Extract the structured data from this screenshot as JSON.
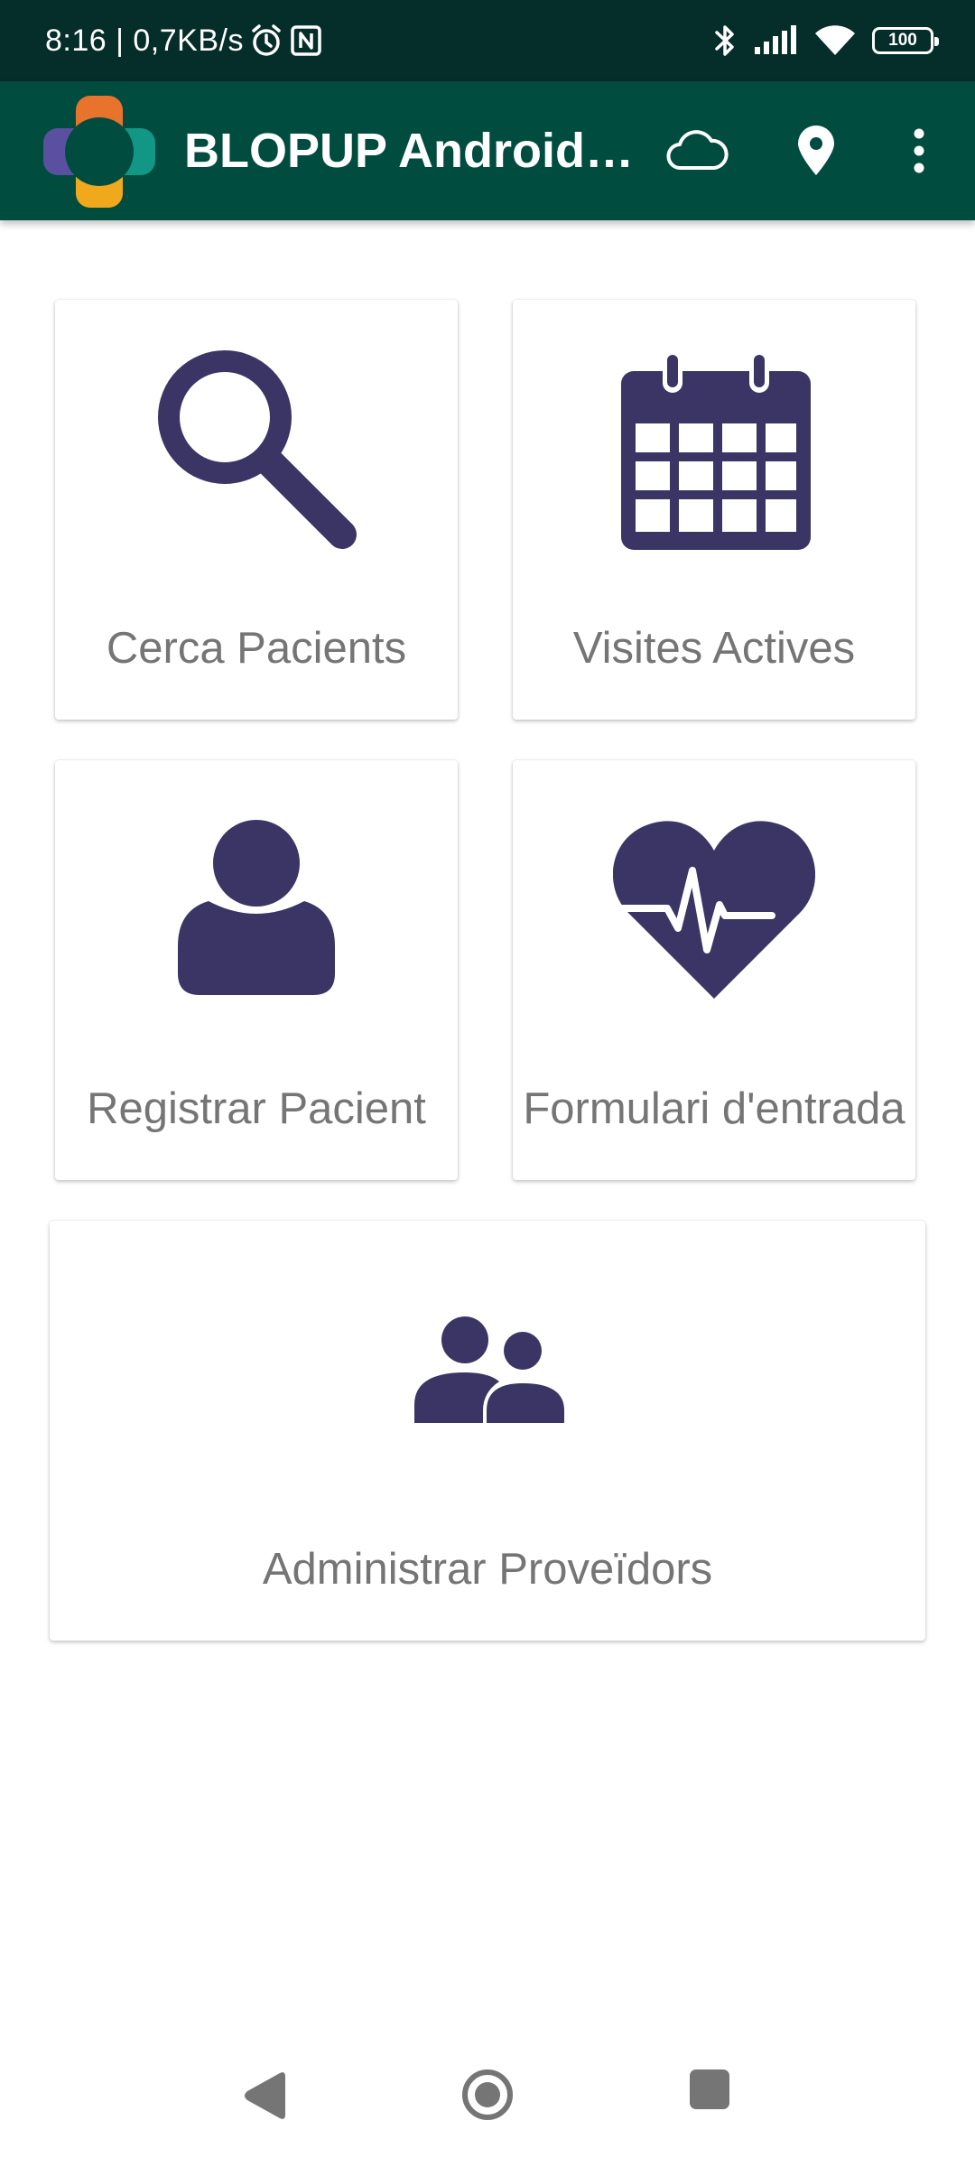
{
  "status_bar": {
    "time_speed": "8:16 | 0,7KB/s",
    "battery": "100"
  },
  "app_bar": {
    "title": "BLOPUP Android…"
  },
  "cards": [
    {
      "label": "Cerca Pacients",
      "icon": "search-icon"
    },
    {
      "label": "Visites Actives",
      "icon": "calendar-icon"
    },
    {
      "label": "Registrar Pacient",
      "icon": "person-icon"
    },
    {
      "label": "Formulari d'entrada",
      "icon": "heart-pulse-icon"
    },
    {
      "label": "Administrar Proveïdors",
      "icon": "group-icon"
    }
  ],
  "colors": {
    "status_bar": "#052d29",
    "app_bar": "#004d40",
    "icon": "#3a3564",
    "label": "#757575",
    "nav": "#757575"
  }
}
